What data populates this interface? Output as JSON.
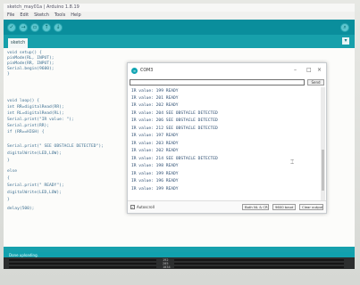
{
  "ide": {
    "window_title": "sketch_may01a | Arduino 1.8.19",
    "menu": [
      "File",
      "Edit",
      "Sketch",
      "Tools",
      "Help"
    ],
    "toolbar_icons": [
      "check-icon",
      "arrow-right-icon",
      "new-file-icon",
      "open-icon",
      "save-icon"
    ],
    "tab_label": "sketch",
    "code_lines": [
      "void setup() {",
      "  pinMode(RL, INPUT);",
      "  pinMode(RR, INPUT);",
      "  Serial.begin(9600);",
      "}",
      "",
      "void loop() {",
      "  int RR=digitalRead(RR);",
      "  int RL=digitalRead(RL);",
      "  Serial.print(\"IR value: \");",
      "  Serial.print(RR);",
      "  if (RR==HIGH) {",
      "",
      "    Serial.print(\" SEE OBSTACLE DETECTED\");",
      "    digitalWrite(LED,LOW);",
      "  }",
      "",
      "  else",
      "  {",
      "    Serial.print(\" READY\");",
      "    digitalWrite(LED,LOW);",
      "  }",
      "delay(500);"
    ],
    "console_header": "Done uploading.",
    "console_lines": [
      "192",
      "205",
      "1034"
    ]
  },
  "serial_monitor": {
    "title": "COM3",
    "send_label": "Send",
    "input_value": "",
    "lines": [
      "IR value: 199  READY",
      "IR value: 201  READY",
      "IR value: 202  READY",
      "IR value: 204  SEE OBSTACLE DETECTED",
      "IR value: 206  SEE OBSTACLE DETECTED",
      "IR value: 212  SEE OBSTACLE DETECTED",
      "IR value: 197  READY",
      "IR value: 203  READY",
      "IR value: 202  READY",
      "IR value: 214  SEE OBSTACLE DETECTED",
      "IR value: 198  READY",
      "IR value: 199  READY",
      "IR value: 196  READY",
      "IR value: 199  READY"
    ],
    "autoscroll_label": "Autoscroll",
    "line_ending": "Both NL & CR",
    "baud_rate": "9600 baud",
    "clear_label": "Clear output"
  },
  "colors": {
    "teal_toolbar": "#0a8e9c",
    "teal_tabs": "#17a0ab",
    "console_bg": "#2c2e2e",
    "code_text": "#3d6f91"
  }
}
